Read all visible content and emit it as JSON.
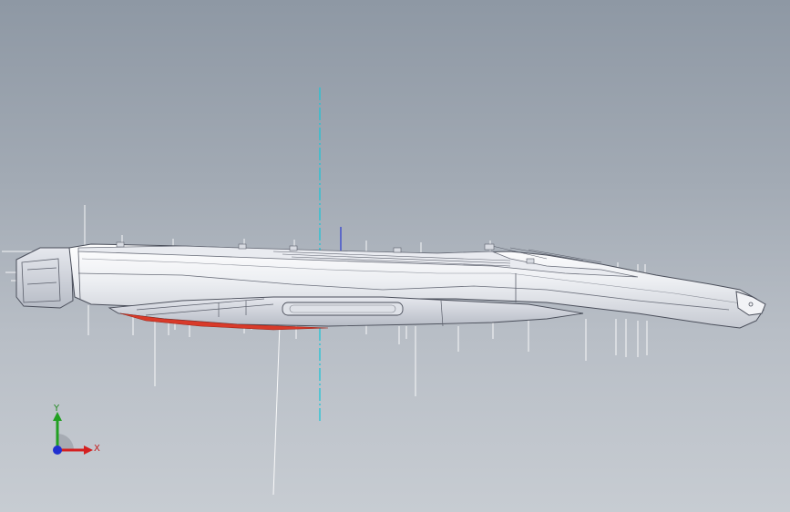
{
  "viewport": {
    "background_top": "#8e98a4",
    "background_bottom": "#c7ccd2"
  },
  "model": {
    "body_color": "#f2f3f6",
    "edge_color": "#4a4e5a",
    "accent_color": "#d83a2a",
    "axis_line_color": "#1fc4d6"
  },
  "triad": {
    "x_label": "X",
    "y_label": "Y",
    "x_color": "#d42020",
    "y_color": "#22a022",
    "z_color": "#2030d0"
  }
}
